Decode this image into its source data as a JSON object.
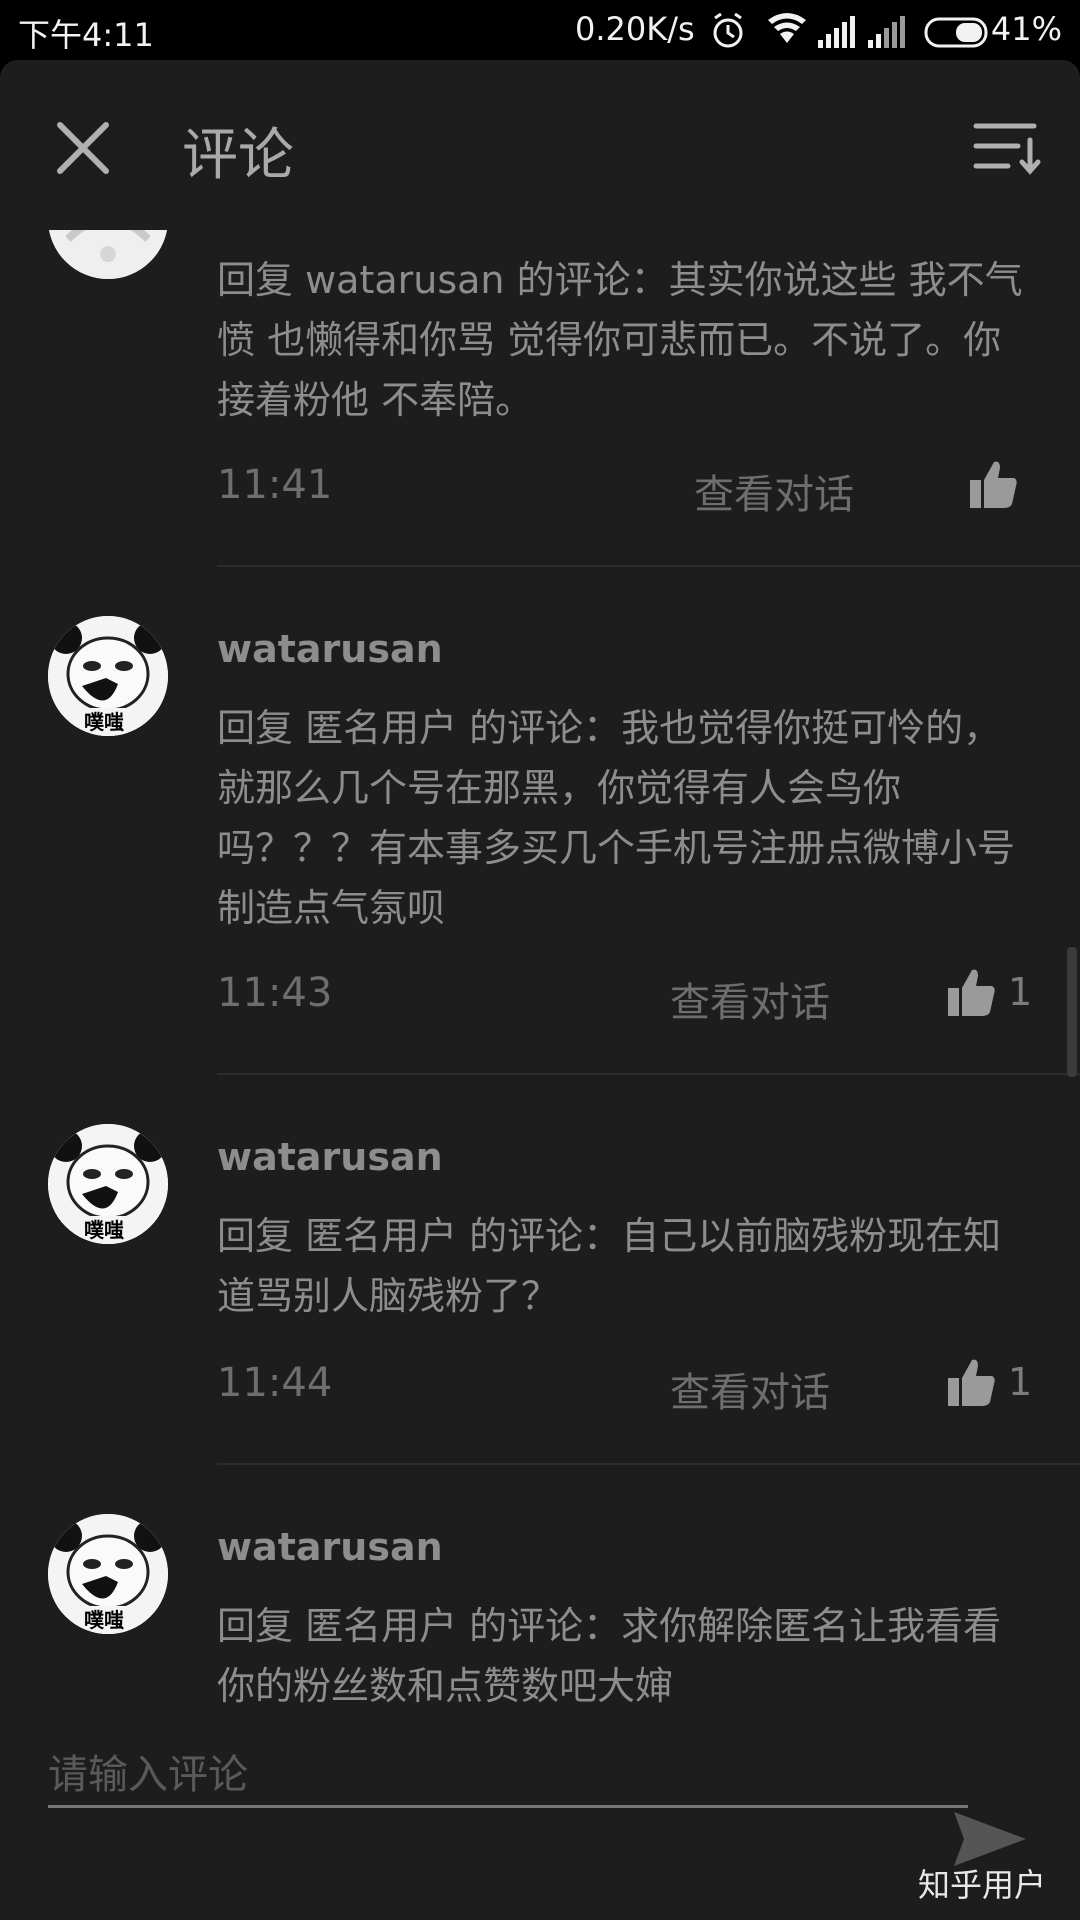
{
  "status_bar": {
    "time": "下午4:11",
    "net_speed": "0.20K/s",
    "battery": "41%"
  },
  "header": {
    "title": "评论"
  },
  "comments": [
    {
      "username": "",
      "body": "回复 watarusan 的评论：其实你说这些 我不气愤 也懒得和你骂 觉得你可悲而已。不说了。你接着粉他 不奉陪。",
      "time": "11:41",
      "view_conversation": "查看对话",
      "likes": ""
    },
    {
      "username": "watarusan",
      "avatar_caption": "噗嗤",
      "body": "回复 匿名用户 的评论：我也觉得你挺可怜的，就那么几个号在那黑，你觉得有人会鸟你吗？？？有本事多买几个手机号注册点微博小号制造点气氛呗",
      "time": "11:43",
      "view_conversation": "查看对话",
      "likes": "1"
    },
    {
      "username": "watarusan",
      "avatar_caption": "噗嗤",
      "body": "回复 匿名用户 的评论：自己以前脑残粉现在知道骂别人脑残粉了？",
      "time": "11:44",
      "view_conversation": "查看对话",
      "likes": "1"
    },
    {
      "username": "watarusan",
      "avatar_caption": "噗嗤",
      "body": "回复 匿名用户 的评论：求你解除匿名让我看看你的粉丝数和点赞数吧大婶",
      "time": "",
      "view_conversation": "",
      "likes": ""
    }
  ],
  "footer": {
    "input_placeholder": "请输入评论",
    "watermark": "知乎用户"
  },
  "icons": [
    "close-icon",
    "sort-icon",
    "thumbs-up-icon",
    "send-icon",
    "alarm-icon",
    "wifi-icon",
    "signal-icon",
    "battery-icon"
  ]
}
